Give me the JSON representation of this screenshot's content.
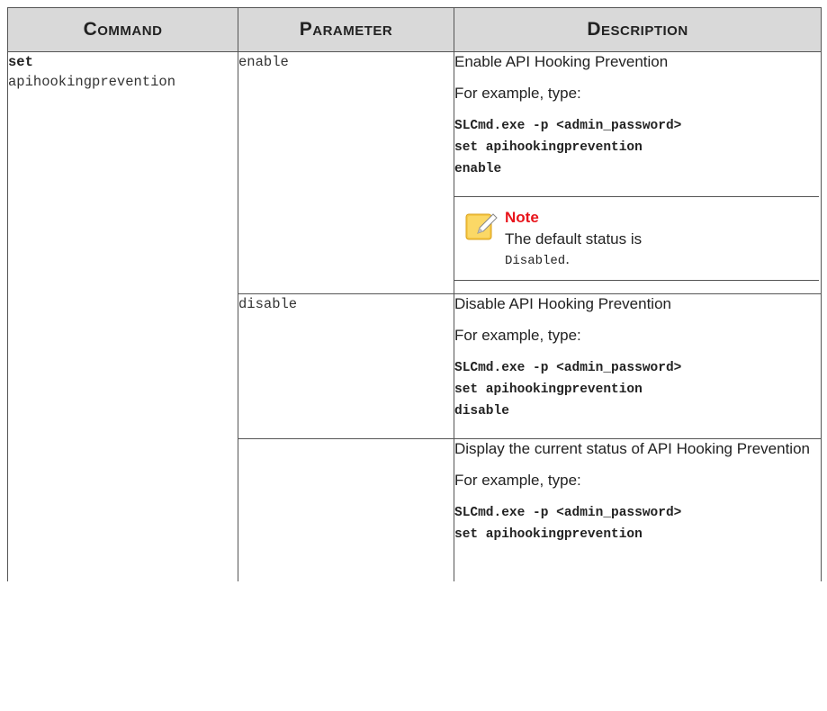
{
  "headers": {
    "command": "Command",
    "parameter": "Parameter",
    "description": "Description"
  },
  "command": {
    "keyword": "set",
    "argument": "apihookingprevention"
  },
  "rows": [
    {
      "parameter": "enable",
      "description": "Enable API Hooking Prevention",
      "example_label": "For example, type:",
      "example_code": "SLCmd.exe -p <admin_password>\nset apihookingprevention\nenable",
      "note": {
        "title": "Note",
        "text": "The default status is",
        "value": "Disabled",
        "suffix": "."
      }
    },
    {
      "parameter": "disable",
      "description": "Disable API Hooking Prevention",
      "example_label": "For example, type:",
      "example_code": "SLCmd.exe -p <admin_password>\nset apihookingprevention\ndisable"
    },
    {
      "parameter": "",
      "description": "Display the current status of API Hooking Prevention",
      "example_label": "For example, type:",
      "example_code": "SLCmd.exe -p <admin_password>\nset apihookingprevention"
    }
  ]
}
